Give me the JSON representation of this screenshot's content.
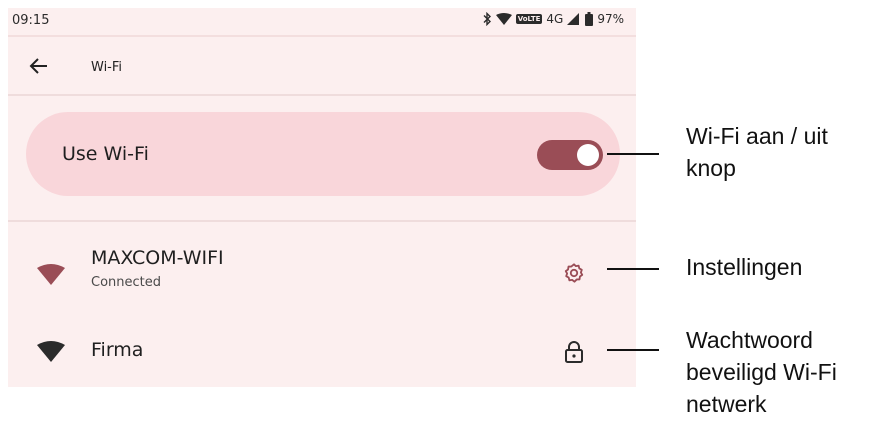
{
  "status_bar": {
    "time": "09:15",
    "volte": "VoLTE",
    "network": "4G",
    "battery": "97%",
    "icons": [
      "bluetooth-icon",
      "wifi-signal-icon",
      "cell-signal-icon",
      "battery-icon"
    ]
  },
  "app_bar": {
    "back_icon": "arrow-left-icon",
    "title": "Wi-Fi"
  },
  "wifi_toggle": {
    "label": "Use Wi-Fi",
    "enabled": true,
    "accent_color": "#9a4d56"
  },
  "networks": [
    {
      "name": "MAXCOM-WIFI",
      "status": "Connected",
      "signal_icon": "wifi-icon",
      "action_icon": "gear-icon",
      "icon_color": "#9a4d56"
    },
    {
      "name": "Firma",
      "status": "",
      "signal_icon": "wifi-icon",
      "action_icon": "lock-icon",
      "icon_color": "#2b2b2b"
    }
  ],
  "annotations": {
    "toggle": [
      "Wi-Fi aan / uit",
      "knop"
    ],
    "settings": [
      "Instellingen"
    ],
    "secured": [
      "Wachtwoord",
      "beveiligd Wi-Fi",
      "netwerk"
    ]
  },
  "colors": {
    "background": "#fcefef",
    "card": "#f9d6da",
    "accent": "#9a4d56"
  }
}
